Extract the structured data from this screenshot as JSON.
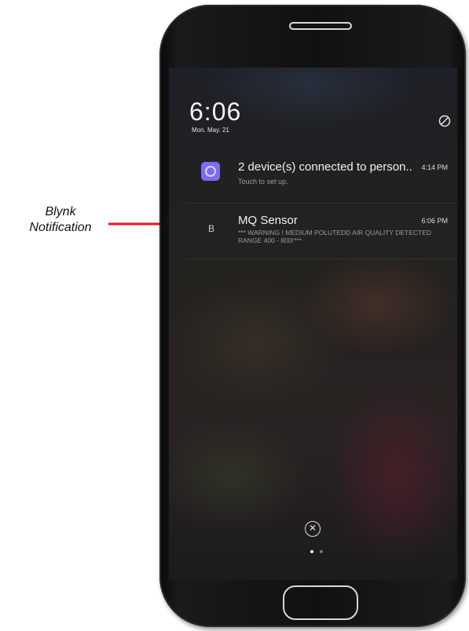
{
  "annotation": {
    "label": "Blynk\nNotification",
    "arrow_color": "#e8141c"
  },
  "lockscreen": {
    "time": "6:06",
    "date": "Mon. May. 21",
    "dnd_icon": "do-not-disturb-icon"
  },
  "notifications": [
    {
      "app_icon": "device-connection-icon",
      "icon_color": "#7b6cf0",
      "title": "2 device(s) connected to person..",
      "subtitle": "Touch to set up.",
      "time": "4:14 PM"
    },
    {
      "app_icon_letter": "B",
      "title": "MQ Sensor",
      "body": "*** WARNING ! MEDIUM POLUTEDD AIR QUALITY DETECTED RANGE 400 - 800!***",
      "time": "6:06 PM"
    }
  ],
  "controls": {
    "clear_all_glyph": "✕",
    "page_indicator": {
      "active": 1,
      "total": 2
    }
  }
}
